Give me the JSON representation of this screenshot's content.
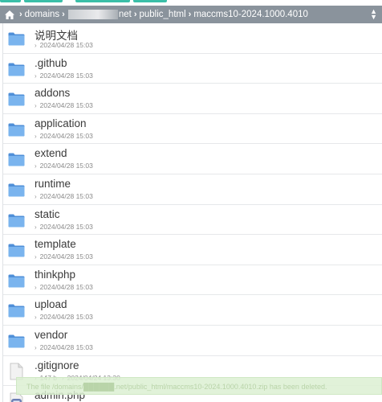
{
  "breadcrumb": {
    "segments": [
      "domains",
      "public_html",
      "maccms10-2024.1000.4010"
    ],
    "redacted_suffix": "net",
    "sort_icon": "sort-icon"
  },
  "files": [
    {
      "name": "说明文档",
      "type": "folder",
      "date": "2024/04/28 15:03",
      "size": ""
    },
    {
      "name": ".github",
      "type": "folder",
      "date": "2024/04/28 15:03",
      "size": ""
    },
    {
      "name": "addons",
      "type": "folder",
      "date": "2024/04/28 15:03",
      "size": ""
    },
    {
      "name": "application",
      "type": "folder",
      "date": "2024/04/28 15:03",
      "size": ""
    },
    {
      "name": "extend",
      "type": "folder",
      "date": "2024/04/28 15:03",
      "size": ""
    },
    {
      "name": "runtime",
      "type": "folder",
      "date": "2024/04/28 15:03",
      "size": ""
    },
    {
      "name": "static",
      "type": "folder",
      "date": "2024/04/28 15:03",
      "size": ""
    },
    {
      "name": "template",
      "type": "folder",
      "date": "2024/04/28 15:03",
      "size": ""
    },
    {
      "name": "thinkphp",
      "type": "folder",
      "date": "2024/04/28 15:03",
      "size": ""
    },
    {
      "name": "upload",
      "type": "folder",
      "date": "2024/04/28 15:03",
      "size": ""
    },
    {
      "name": "vendor",
      "type": "folder",
      "date": "2024/04/28 15:03",
      "size": ""
    },
    {
      "name": ".gitignore",
      "type": "file",
      "date": "2024/04/24 13:30",
      "size": "147 b"
    },
    {
      "name": "admin.php",
      "type": "php",
      "date": "",
      "size": ""
    }
  ],
  "toast": {
    "text": "The file /domains/██████.net/public_html/maccms10-2024.1000.4010.zip has been deleted."
  },
  "colors": {
    "breadcrumb_bg": "#8a939c",
    "folder": "#6aa6e8",
    "toolbar_accent": "#3bbfa8",
    "toast_bg": "#dcf0d2"
  }
}
